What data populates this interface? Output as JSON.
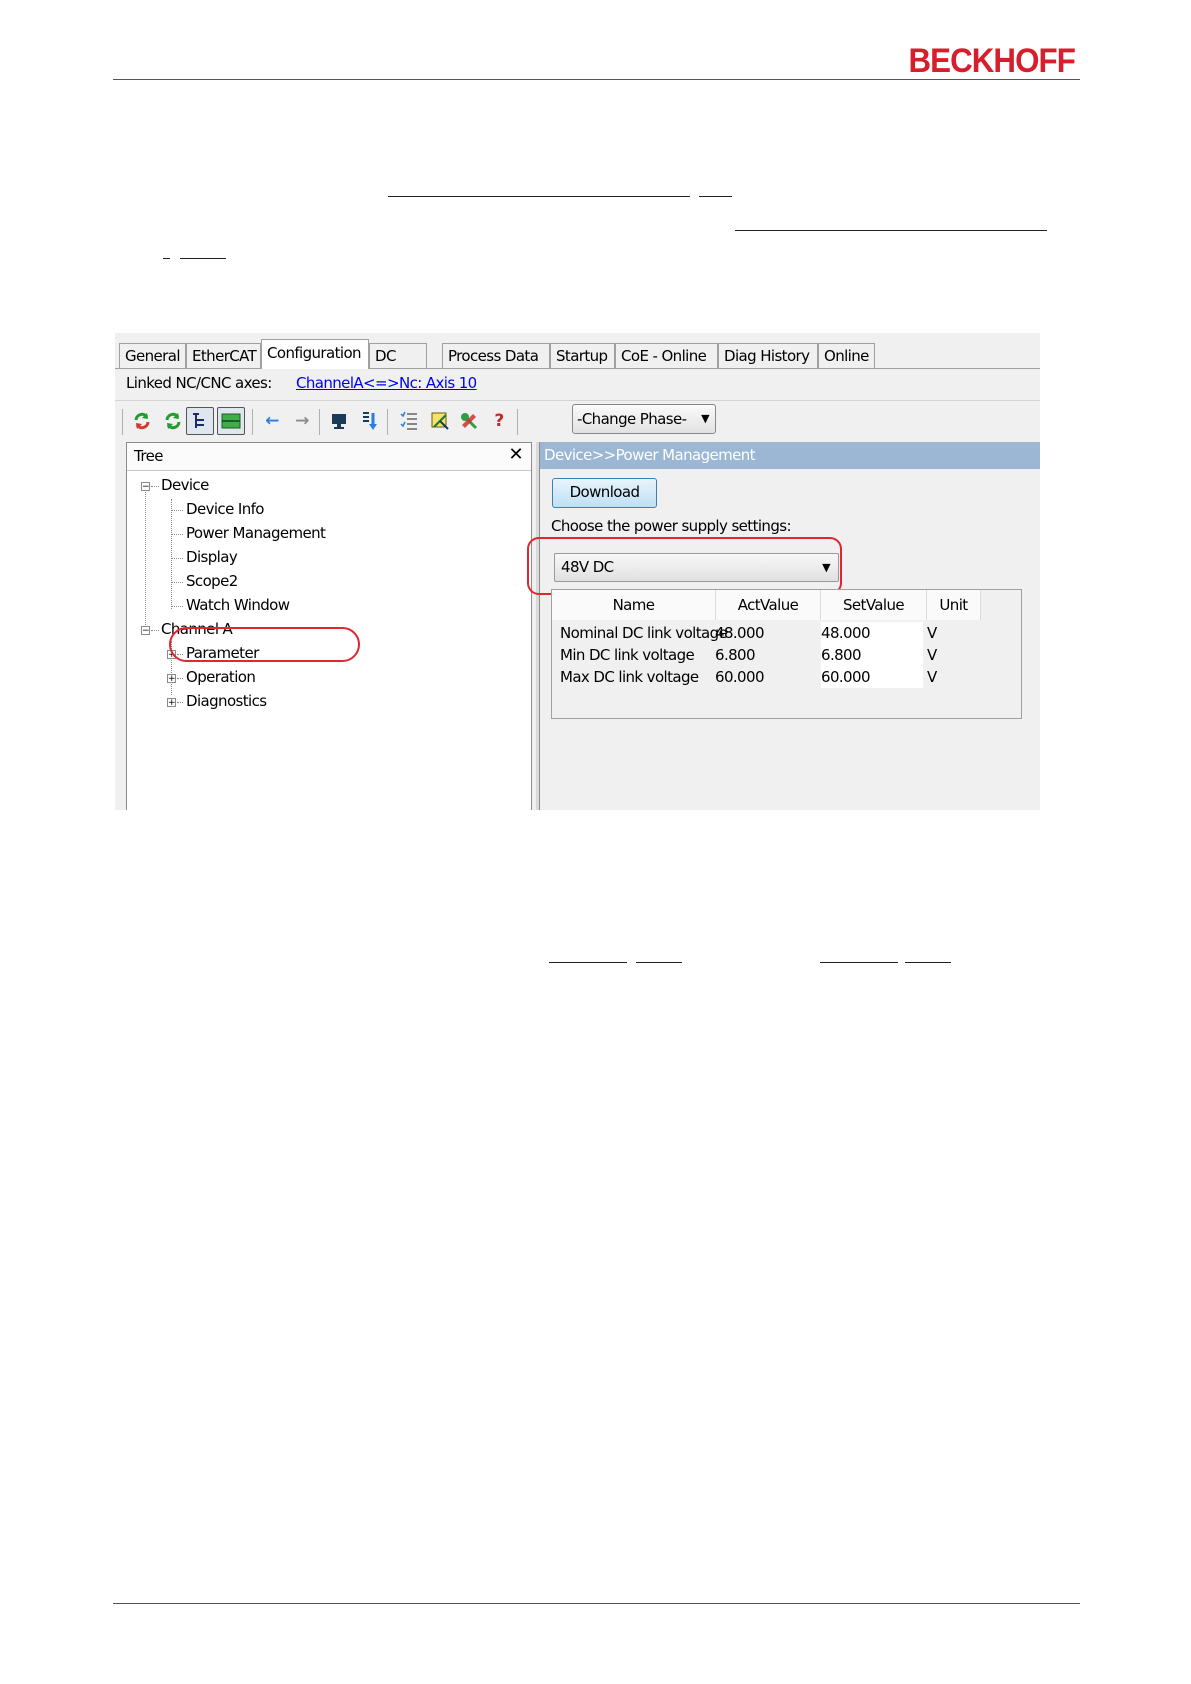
{
  "brand": {
    "logo_text": "BECKHOFF"
  },
  "window": {
    "tabs": [
      "General",
      "EtherCAT",
      "Configuration",
      "DC",
      "Process Data",
      "Startup",
      "CoE - Online",
      "Diag History",
      "Online"
    ],
    "active_tab": "Configuration",
    "linked_label": "Linked NC/CNC axes:",
    "linked_value": "ChannelA<=>Nc: Axis 10",
    "toolbar": {
      "icons": [
        "reload-green-icon",
        "reload-icon",
        "tree-view-toggle-icon",
        "list-view-toggle-icon",
        "back-arrow-icon",
        "forward-arrow-icon",
        "monitor-icon",
        "download-arrow-icon",
        "checklist-icon",
        "wizard-icon",
        "tools-icon",
        "help-icon"
      ],
      "help_glyph": "?",
      "phase_select": "-Change Phase-"
    },
    "tree": {
      "title": "Tree",
      "close_glyph": "✕",
      "device": {
        "label": "Device",
        "children": [
          "Device Info",
          "Power Management",
          "Display",
          "Scope2",
          "Watch Window"
        ]
      },
      "channel": {
        "label": "Channel A",
        "children": [
          "Parameter",
          "Operation",
          "Diagnostics"
        ]
      },
      "expander_collapsed": "+",
      "expander_expanded": "−"
    },
    "pm": {
      "title": "Device>>Power Management",
      "download": "Download",
      "supply_label": "Choose the power supply settings:",
      "supply_value": "48V DC",
      "table": {
        "headers": [
          "Name",
          "ActValue",
          "SetValue",
          "Unit"
        ],
        "rows": [
          [
            "Nominal DC link voltage",
            "48.000",
            "48.000",
            "V"
          ],
          [
            "Min DC link voltage",
            "6.800",
            "6.800",
            "V"
          ],
          [
            "Max DC link voltage",
            "60.000",
            "60.000",
            "V"
          ]
        ]
      }
    }
  },
  "colors": {
    "brand_red": "#d81e2c",
    "highlight_red": "#e0262f",
    "pane_header": "#9bb7d4",
    "link_blue": "#0000ee"
  }
}
